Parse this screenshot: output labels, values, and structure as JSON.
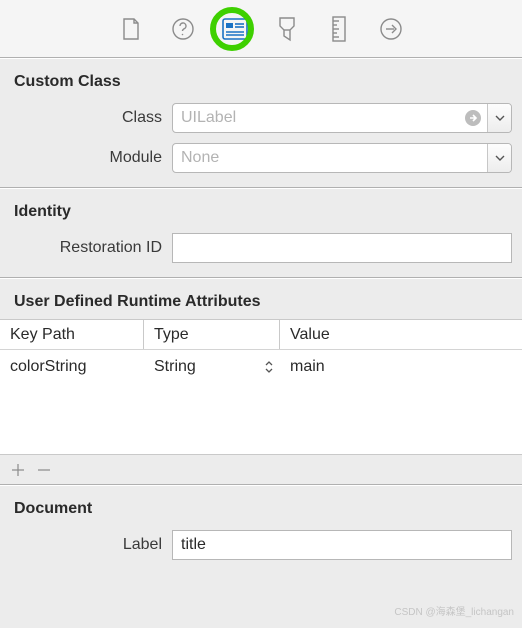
{
  "toolbar": {
    "items": [
      "file",
      "help",
      "identity",
      "size",
      "ruler",
      "connections"
    ],
    "active_index": 2
  },
  "custom_class": {
    "title": "Custom Class",
    "class_label": "Class",
    "class_placeholder": "UILabel",
    "module_label": "Module",
    "module_placeholder": "None"
  },
  "identity": {
    "title": "Identity",
    "restoration_label": "Restoration ID",
    "restoration_value": ""
  },
  "udra": {
    "title": "User Defined Runtime Attributes",
    "headers": {
      "key": "Key Path",
      "type": "Type",
      "value": "Value"
    },
    "rows": [
      {
        "key": "colorString",
        "type": "String",
        "value": "main"
      }
    ]
  },
  "document": {
    "title": "Document",
    "label_label": "Label",
    "label_value": "title"
  },
  "watermark": "CSDN @海森堡_lichangan"
}
